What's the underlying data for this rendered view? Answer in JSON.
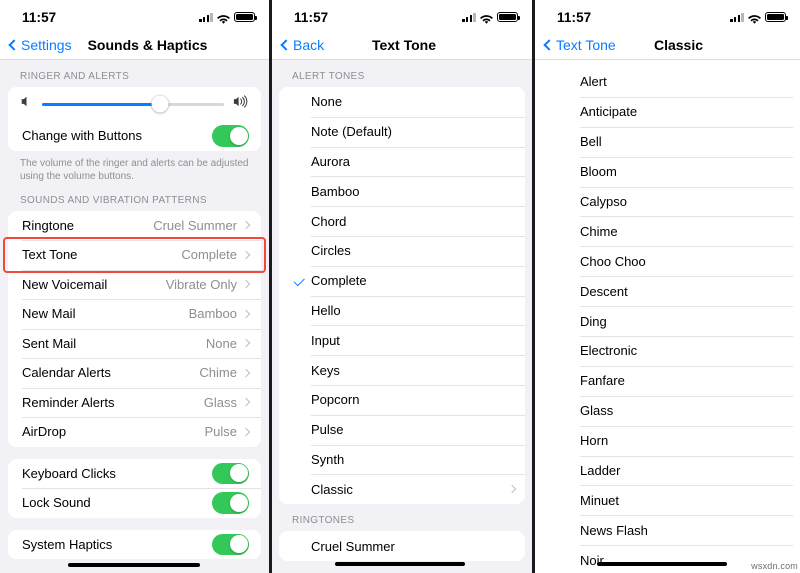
{
  "status_bar": {
    "time": "11:57",
    "signal_icon": "cellular-signal-icon",
    "wifi_icon": "wifi-icon",
    "battery_icon": "battery-full-icon"
  },
  "colors": {
    "accent_blue": "#0a7cff",
    "toggle_green": "#34c759",
    "highlight_red": "#ee4b3c",
    "group_background": "#f2f1f6",
    "secondary_text": "#8e8e93"
  },
  "panel1": {
    "nav": {
      "back_label": "Settings",
      "title": "Sounds & Haptics"
    },
    "section1_header": "RINGER AND ALERTS",
    "volume": {
      "fill_percent": 65,
      "left_icon": "speaker-low-icon",
      "right_icon": "speaker-high-icon"
    },
    "change_with_buttons": {
      "label": "Change with Buttons",
      "state": "on"
    },
    "footnote": "The volume of the ringer and alerts can be adjusted using the volume buttons.",
    "section2_header": "SOUNDS AND VIBRATION PATTERNS",
    "sound_rows": [
      {
        "label": "Ringtone",
        "value": "Cruel Summer"
      },
      {
        "label": "Text Tone",
        "value": "Complete"
      },
      {
        "label": "New Voicemail",
        "value": "Vibrate Only"
      },
      {
        "label": "New Mail",
        "value": "Bamboo"
      },
      {
        "label": "Sent Mail",
        "value": "None"
      },
      {
        "label": "Calendar Alerts",
        "value": "Chime"
      },
      {
        "label": "Reminder Alerts",
        "value": "Glass"
      },
      {
        "label": "AirDrop",
        "value": "Pulse"
      }
    ],
    "toggle_rows": [
      {
        "label": "Keyboard Clicks",
        "state": "on"
      },
      {
        "label": "Lock Sound",
        "state": "on"
      }
    ],
    "haptics_row": {
      "label": "System Haptics",
      "state": "on"
    }
  },
  "panel2": {
    "nav": {
      "back_label": "Back",
      "title": "Text Tone"
    },
    "section1_header": "ALERT TONES",
    "alert_tones": [
      {
        "label": "None",
        "selected": false,
        "has_chevron": false
      },
      {
        "label": "Note (Default)",
        "selected": false,
        "has_chevron": false
      },
      {
        "label": "Aurora",
        "selected": false,
        "has_chevron": false
      },
      {
        "label": "Bamboo",
        "selected": false,
        "has_chevron": false
      },
      {
        "label": "Chord",
        "selected": false,
        "has_chevron": false
      },
      {
        "label": "Circles",
        "selected": false,
        "has_chevron": false
      },
      {
        "label": "Complete",
        "selected": true,
        "has_chevron": false
      },
      {
        "label": "Hello",
        "selected": false,
        "has_chevron": false
      },
      {
        "label": "Input",
        "selected": false,
        "has_chevron": false
      },
      {
        "label": "Keys",
        "selected": false,
        "has_chevron": false
      },
      {
        "label": "Popcorn",
        "selected": false,
        "has_chevron": false
      },
      {
        "label": "Pulse",
        "selected": false,
        "has_chevron": false
      },
      {
        "label": "Synth",
        "selected": false,
        "has_chevron": false
      },
      {
        "label": "Classic",
        "selected": false,
        "has_chevron": true
      }
    ],
    "section2_header": "RINGTONES",
    "ringtones": [
      {
        "label": "Cruel Summer",
        "selected": false,
        "has_chevron": false
      }
    ]
  },
  "panel3": {
    "nav": {
      "back_label": "Text Tone",
      "title": "Classic"
    },
    "classic_tones": [
      {
        "label": "Alert"
      },
      {
        "label": "Anticipate"
      },
      {
        "label": "Bell"
      },
      {
        "label": "Bloom"
      },
      {
        "label": "Calypso"
      },
      {
        "label": "Chime"
      },
      {
        "label": "Choo Choo"
      },
      {
        "label": "Descent"
      },
      {
        "label": "Ding"
      },
      {
        "label": "Electronic"
      },
      {
        "label": "Fanfare"
      },
      {
        "label": "Glass"
      },
      {
        "label": "Horn"
      },
      {
        "label": "Ladder"
      },
      {
        "label": "Minuet"
      },
      {
        "label": "News Flash"
      },
      {
        "label": "Noir"
      }
    ]
  },
  "watermark": "wsxdn.com"
}
